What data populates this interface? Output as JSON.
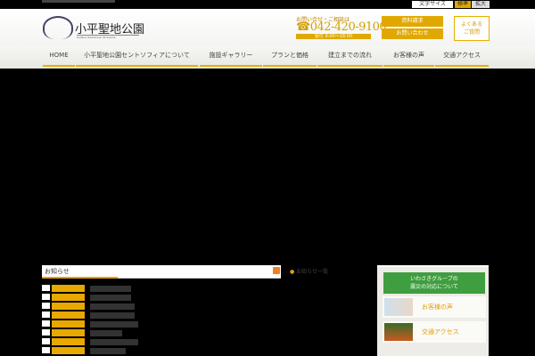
{
  "topbar": {
    "font_size_label": "文字サイズ",
    "standard": "標準",
    "large": "拡大"
  },
  "logo": {
    "name": "小平聖地公園",
    "subtitle": "Kodaira Seichikoen St.Sophia"
  },
  "contact": {
    "label": "お問い合せ・ご相談は",
    "phone": "042-420-9100",
    "hours": "受付 9:00～18:00"
  },
  "buttons": {
    "request": "資料請求",
    "inquiry": "お問い合わせ",
    "faq_line1": "よくある",
    "faq_line2": "ご質問"
  },
  "nav": [
    "HOME",
    "小平聖地公園セントソフィアについて",
    "施設ギャラリー",
    "プランと価格",
    "建立までの流れ",
    "お客様の声",
    "交通アクセス"
  ],
  "news": {
    "title": "お知らせ",
    "more": "お知らせ一覧"
  },
  "sidebar": {
    "quake_line1": "いわさきグループの",
    "quake_line2": "震災の対応について",
    "voice": "お客様の声",
    "access": "交通アクセス"
  },
  "colors": {
    "accent": "#e0a800",
    "green": "#3f9e3f"
  }
}
